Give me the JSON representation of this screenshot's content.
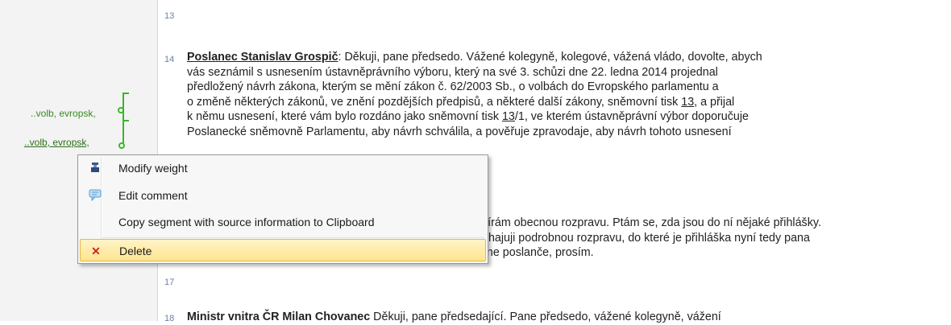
{
  "gutter": {
    "codes": [
      {
        "text": "..volb, evropsk,"
      },
      {
        "text": "..volb, evropsk,"
      }
    ]
  },
  "line_numbers": {
    "n13": "13",
    "n14": "14",
    "n17": "17",
    "n18": "18"
  },
  "segment14": {
    "speaker": "Poslanec Stanislav Grospič",
    "line1_rest": ": Děkuji, pane předsedo. Vážené kolegyně, kolegové, vážená vládo, dovolte, abych",
    "line2": "vás seznámil s usnesením ústavněprávního výboru, který na své 3. schůzi dne 22. ledna 2014 projednal",
    "line3": "předložený návrh zákona, kterým se mění zákon č. 62/2003 Sb., o volbách do Evropského parlamentu a",
    "line4_a": "o změně některých zákonů, ve znění pozdějších předpisů, a některé další zákony, sněmovní tisk ",
    "line4_link": "13",
    "line4_b": ", a přijal",
    "line5_a": "k němu usnesení, které vám bylo rozdáno jako sněmovní tisk ",
    "line5_link": "13",
    "line5_b": "/1, ve kterém ústavněprávní výbor doporučuje",
    "line6": "Poslanecké sněmovně Parlamentu, aby návrh schválila, a pověřuje zpravodaje, aby návrh tohoto usnesení"
  },
  "segment16": {
    "line1": "vírám obecnou rozpravu. Ptám se, zda jsou do ní nějaké přihlášky.",
    "line2": "ahajuji podrobnou rozpravu, do které je přihláška nyní tedy pana",
    "line3": "poslance Chovance, a prosím ho, aby vystoupil u pultu. Pane poslanče, prosím."
  },
  "segment18": {
    "speaker": "Ministr vnitra ČR Milan Chovanec",
    "rest": " Děkuji, pane předsedající. Pane předsedo, vážené kolegyně, vážení"
  },
  "context_menu": {
    "items": [
      {
        "label": "Modify weight",
        "icon": "weight-icon"
      },
      {
        "label": "Edit comment",
        "icon": "comment-icon"
      },
      {
        "label": "Copy segment with source information to Clipboard",
        "icon": ""
      },
      {
        "label": "Delete",
        "icon": "delete-icon"
      }
    ],
    "highlighted_index": 3
  },
  "colors": {
    "code_green": "#3bb52a",
    "highlight": "#ffe58f",
    "delete_red": "#d0271d"
  }
}
